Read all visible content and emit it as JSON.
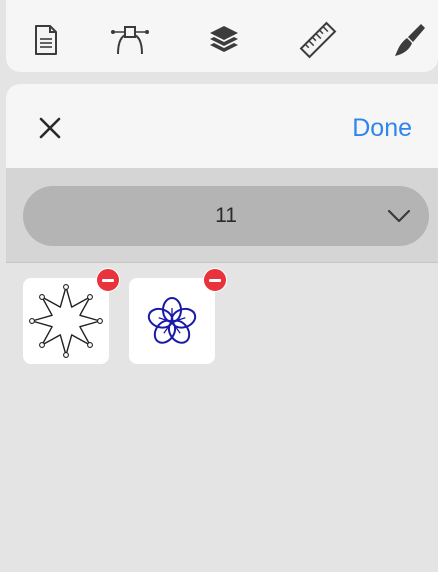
{
  "toolbar": {
    "tools": [
      {
        "icon": "document-icon"
      },
      {
        "icon": "bezier-pen-icon"
      },
      {
        "icon": "layers-icon"
      },
      {
        "icon": "ruler-icon"
      },
      {
        "icon": "paintbrush-icon"
      }
    ]
  },
  "header": {
    "close_icon": "close-icon",
    "done_label": "Done"
  },
  "picker": {
    "value": "11",
    "icon": "chevron-down-icon"
  },
  "gallery": {
    "shapes": [
      {
        "icon": "star-shape-icon",
        "remove_icon": "remove-icon"
      },
      {
        "icon": "flower-shape-icon",
        "remove_icon": "remove-icon"
      }
    ]
  },
  "colors": {
    "accent": "#2f86ec",
    "remove": "#e8323c",
    "flower": "#1a1aa8"
  }
}
